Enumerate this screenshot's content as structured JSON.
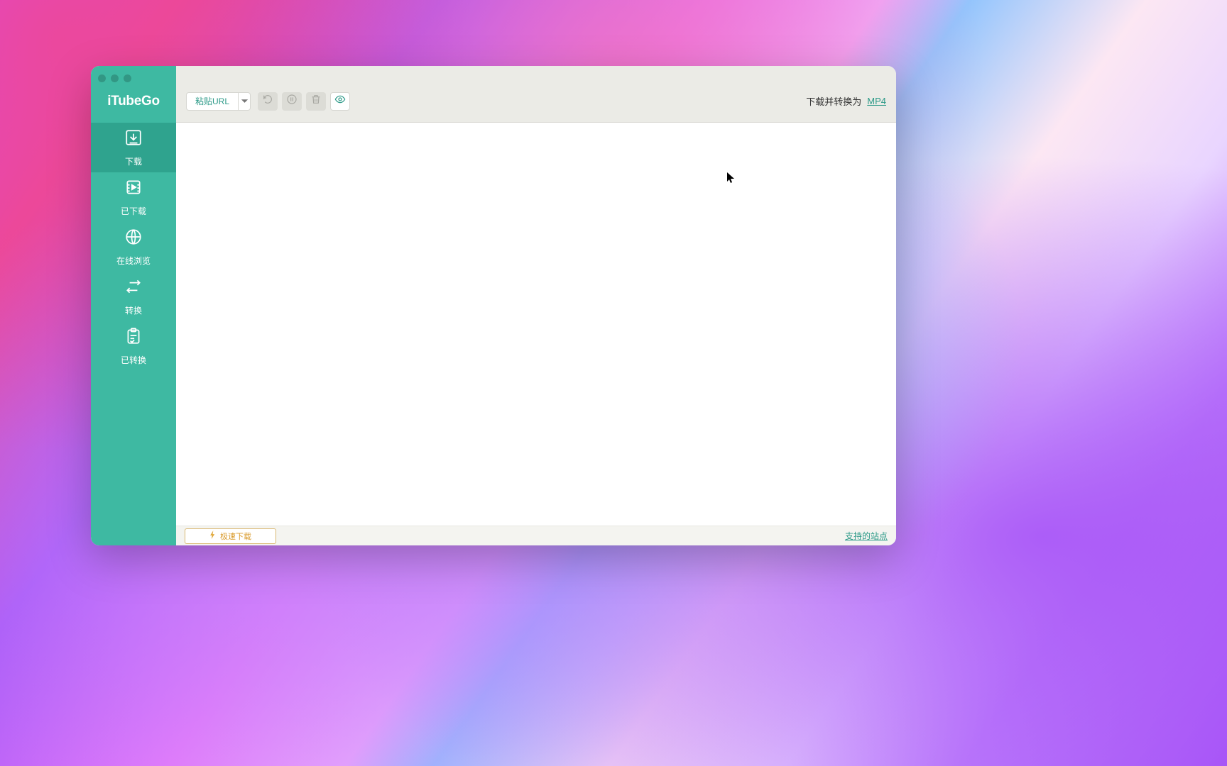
{
  "app": {
    "name": "iTubeGo"
  },
  "sidebar": {
    "items": [
      {
        "label": "下载",
        "icon": "download-box-icon",
        "active": true
      },
      {
        "label": "已下载",
        "icon": "film-icon",
        "active": false
      },
      {
        "label": "在线浏览",
        "icon": "globe-icon",
        "active": false
      },
      {
        "label": "转换",
        "icon": "convert-icon",
        "active": false
      },
      {
        "label": "已转换",
        "icon": "clipboard-check-icon",
        "active": false
      }
    ]
  },
  "toolbar": {
    "paste_label": "粘贴URL",
    "retry_title": "重试",
    "pause_title": "暂停",
    "delete_title": "删除",
    "show_title": "显示",
    "convert_label": "下载并转换为",
    "format": "MP4"
  },
  "statusbar": {
    "turbo_label": "极速下载",
    "sites_link": "支持的站点"
  },
  "colors": {
    "accent": "#3eb9a2",
    "accent_dark": "#2fa38e",
    "accent_text": "#2d9a88",
    "turbo": "#d99a2b"
  }
}
